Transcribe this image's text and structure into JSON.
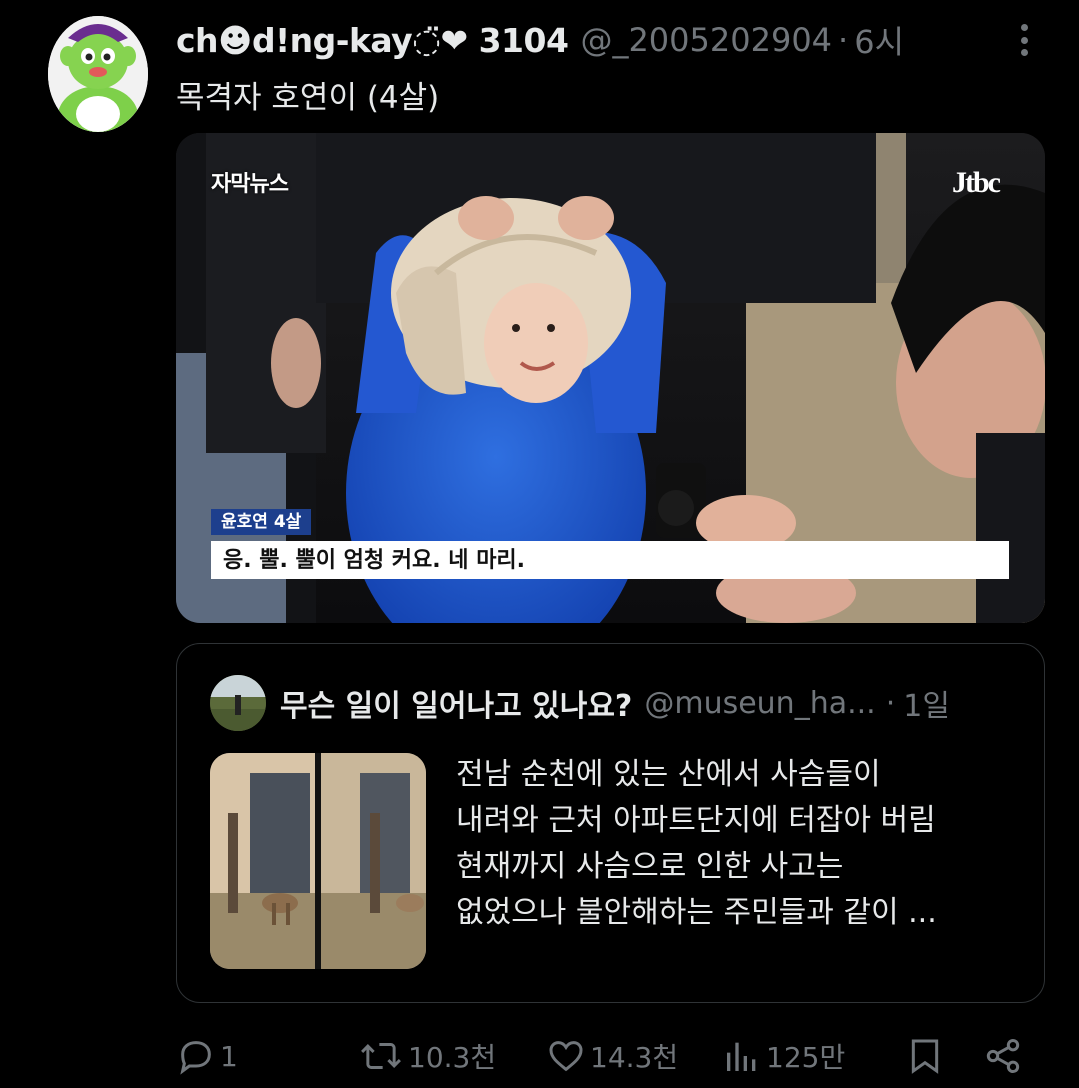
{
  "tweet": {
    "display_name": "ch☻d!ng-kay◌̈❤ 3104",
    "handle": "@_2005202904",
    "separator": "·",
    "time": "6시",
    "text": "목격자 호연이 (4살)"
  },
  "media": {
    "news_tag": "자막뉴스",
    "brand": "Jtbc",
    "caption_label": "윤호연 4살",
    "subtitle": "응. 뿔. 뿔이 엄청 커요. 네 마리."
  },
  "quote": {
    "display_name": "무슨 일이 일어나고 있나요?",
    "handle": "@museun_ha...",
    "separator": "·",
    "time": "1일",
    "lines": [
      "전남 순천에 있는 산에서 사슴들이",
      "내려와 근처 아파트단지에 터잡아 버림",
      "현재까지 사슴으로 인한 사고는",
      "없었으나 불안해하는 주민들과 같이 ..."
    ]
  },
  "actions": {
    "reply_count": "1",
    "retweet_count": "10.3천",
    "like_count": "14.3천",
    "view_count": "125만"
  },
  "icons": {
    "more": "more-dots-icon",
    "reply": "reply-icon",
    "retweet": "retweet-icon",
    "like": "heart-icon",
    "views": "views-chart-icon",
    "bookmark": "bookmark-icon",
    "share": "share-icon"
  },
  "colors": {
    "background": "#000000",
    "text": "#e7e9ea",
    "secondary": "#71767b",
    "border": "#2f3336",
    "caption_label_bg": "#1d3f8d"
  }
}
